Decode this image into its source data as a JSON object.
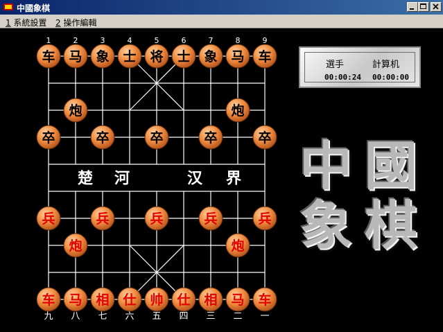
{
  "window": {
    "title": "中國象棋",
    "controls": {
      "minimize": "minimize-icon",
      "maximize": "maximize-icon",
      "close": "close-icon"
    }
  },
  "menu": [
    {
      "accel": "1",
      "label": "系統設置"
    },
    {
      "accel": "2",
      "label": "操作編輯"
    }
  ],
  "board": {
    "top_numbers": [
      "1",
      "2",
      "3",
      "4",
      "5",
      "6",
      "7",
      "8",
      "9"
    ],
    "bottom_numbers": [
      "九",
      "八",
      "七",
      "六",
      "五",
      "四",
      "三",
      "二",
      "一"
    ],
    "river_left": [
      "楚",
      "河"
    ],
    "river_right": [
      "汉",
      "界"
    ],
    "colors": {
      "board_bg": "#000000",
      "lines": "#ffffff",
      "piece_fill": "#e8803a",
      "black_text": "#000000",
      "red_text": "#e00000"
    },
    "pieces": [
      {
        "side": "black",
        "label": "车",
        "file": 1,
        "rank": 1
      },
      {
        "side": "black",
        "label": "马",
        "file": 2,
        "rank": 1
      },
      {
        "side": "black",
        "label": "象",
        "file": 3,
        "rank": 1
      },
      {
        "side": "black",
        "label": "士",
        "file": 4,
        "rank": 1
      },
      {
        "side": "black",
        "label": "将",
        "file": 5,
        "rank": 1
      },
      {
        "side": "black",
        "label": "士",
        "file": 6,
        "rank": 1
      },
      {
        "side": "black",
        "label": "象",
        "file": 7,
        "rank": 1
      },
      {
        "side": "black",
        "label": "马",
        "file": 8,
        "rank": 1
      },
      {
        "side": "black",
        "label": "车",
        "file": 9,
        "rank": 1
      },
      {
        "side": "black",
        "label": "炮",
        "file": 2,
        "rank": 3
      },
      {
        "side": "black",
        "label": "炮",
        "file": 8,
        "rank": 3
      },
      {
        "side": "black",
        "label": "卒",
        "file": 1,
        "rank": 4
      },
      {
        "side": "black",
        "label": "卒",
        "file": 3,
        "rank": 4
      },
      {
        "side": "black",
        "label": "卒",
        "file": 5,
        "rank": 4
      },
      {
        "side": "black",
        "label": "卒",
        "file": 7,
        "rank": 4
      },
      {
        "side": "black",
        "label": "卒",
        "file": 9,
        "rank": 4
      },
      {
        "side": "red",
        "label": "兵",
        "file": 1,
        "rank": 7
      },
      {
        "side": "red",
        "label": "兵",
        "file": 3,
        "rank": 7
      },
      {
        "side": "red",
        "label": "兵",
        "file": 5,
        "rank": 7
      },
      {
        "side": "red",
        "label": "兵",
        "file": 7,
        "rank": 7
      },
      {
        "side": "red",
        "label": "兵",
        "file": 9,
        "rank": 7
      },
      {
        "side": "red",
        "label": "炮",
        "file": 2,
        "rank": 8
      },
      {
        "side": "red",
        "label": "炮",
        "file": 8,
        "rank": 8
      },
      {
        "side": "red",
        "label": "车",
        "file": 1,
        "rank": 10
      },
      {
        "side": "red",
        "label": "马",
        "file": 2,
        "rank": 10
      },
      {
        "side": "red",
        "label": "相",
        "file": 3,
        "rank": 10
      },
      {
        "side": "red",
        "label": "仕",
        "file": 4,
        "rank": 10
      },
      {
        "side": "red",
        "label": "帅",
        "file": 5,
        "rank": 10
      },
      {
        "side": "red",
        "label": "仕",
        "file": 6,
        "rank": 10
      },
      {
        "side": "red",
        "label": "相",
        "file": 7,
        "rank": 10
      },
      {
        "side": "red",
        "label": "马",
        "file": 8,
        "rank": 10
      },
      {
        "side": "red",
        "label": "车",
        "file": 9,
        "rank": 10
      }
    ]
  },
  "timer": {
    "player_label": "選手",
    "player_time": "00:00:24",
    "computer_label": "計算机",
    "computer_time": "00:00:00"
  },
  "logo": {
    "chars": [
      "中",
      "國",
      "象",
      "棋"
    ]
  }
}
